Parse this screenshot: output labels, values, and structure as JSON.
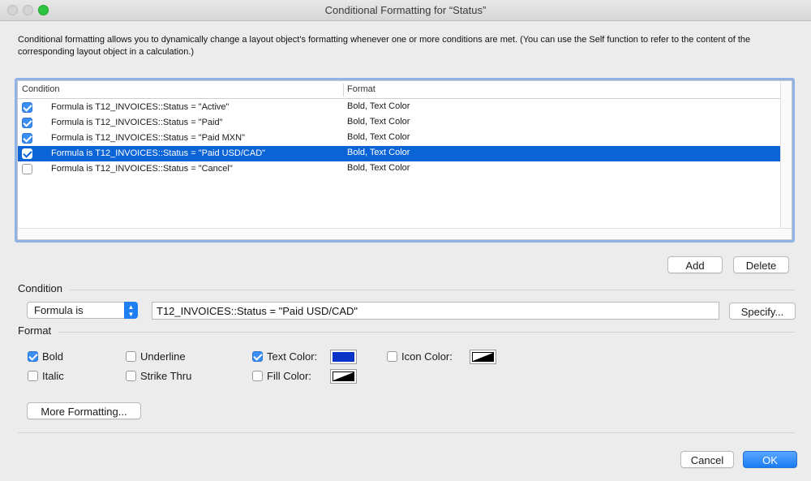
{
  "window": {
    "title": "Conditional Formatting for “Status”"
  },
  "description": "Conditional formatting allows you to dynamically change a layout object’s formatting whenever one or more conditions are met.  (You can use the Self function to refer to the content of the corresponding layout object in a calculation.)",
  "table": {
    "headers": {
      "condition": "Condition",
      "format": "Format"
    },
    "rows": [
      {
        "enabled": true,
        "condition": "Formula is T12_INVOICES::Status = \"Active\"",
        "format": "Bold, Text Color"
      },
      {
        "enabled": true,
        "condition": "Formula is T12_INVOICES::Status = \"Paid\"",
        "format": "Bold, Text Color"
      },
      {
        "enabled": true,
        "condition": "Formula is T12_INVOICES::Status = \"Paid MXN\"",
        "format": "Bold, Text Color"
      },
      {
        "enabled": true,
        "selected": true,
        "condition": "Formula is T12_INVOICES::Status = \"Paid USD/CAD\"",
        "format": "Bold, Text Color"
      },
      {
        "enabled": false,
        "condition": "Formula is T12_INVOICES::Status = \"Cancel\"",
        "format": "Bold, Text Color"
      }
    ]
  },
  "buttons": {
    "add": "Add",
    "delete": "Delete",
    "specify": "Specify...",
    "more_formatting": "More Formatting...",
    "cancel": "Cancel",
    "ok": "OK"
  },
  "condition": {
    "section_label": "Condition",
    "type_selected": "Formula is",
    "formula": "T12_INVOICES::Status = \"Paid USD/CAD\""
  },
  "format": {
    "section_label": "Format",
    "bold": {
      "label": "Bold",
      "checked": true
    },
    "italic": {
      "label": "Italic",
      "checked": false
    },
    "underline": {
      "label": "Underline",
      "checked": false
    },
    "strike_thru": {
      "label": "Strike Thru",
      "checked": false
    },
    "text_color": {
      "label": "Text Color:",
      "checked": true,
      "color": "#0a34c8"
    },
    "fill_color": {
      "label": "Fill Color:",
      "checked": false
    },
    "icon_color": {
      "label": "Icon Color:",
      "checked": false
    }
  },
  "colors": {
    "accent": "#1a7cf3",
    "selection": "#0b64d6"
  }
}
